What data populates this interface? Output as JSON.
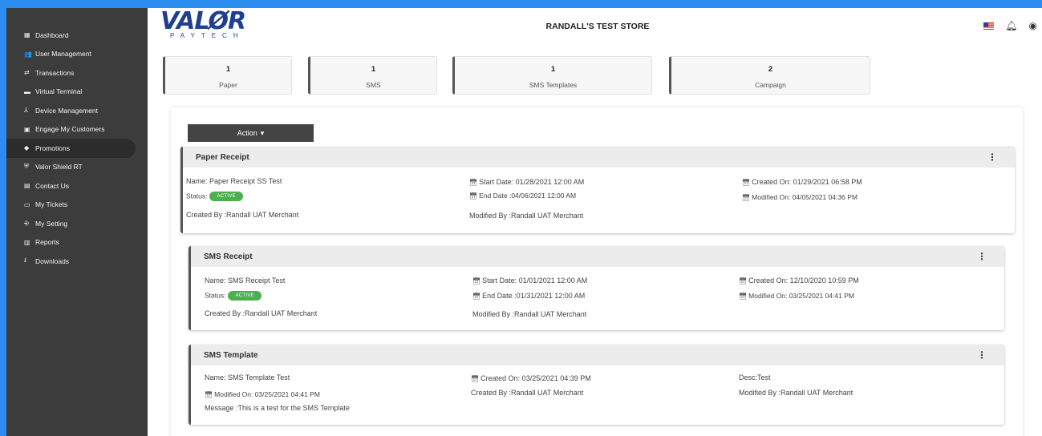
{
  "sidebar": {
    "items": [
      {
        "label": "Dashboard",
        "icon": "dashboard-icon",
        "glyph": "▦"
      },
      {
        "label": "User Management",
        "icon": "users-icon",
        "glyph": "👥"
      },
      {
        "label": "Transactions",
        "icon": "transfer-icon",
        "glyph": "⇄"
      },
      {
        "label": "Virtual Terminal",
        "icon": "terminal-icon",
        "glyph": "▬"
      },
      {
        "label": "Device Management",
        "icon": "device-tree-icon",
        "glyph": "⅄"
      },
      {
        "label": "Engage My Customers",
        "icon": "engage-icon",
        "glyph": "▣"
      },
      {
        "label": "Promotions",
        "icon": "tag-icon",
        "glyph": "◆"
      },
      {
        "label": "Valor Shield RT",
        "icon": "shield-icon",
        "glyph": "⛨"
      },
      {
        "label": "Contact Us",
        "icon": "contact-icon",
        "glyph": "▤"
      },
      {
        "label": "My Tickets",
        "icon": "ticket-icon",
        "glyph": "▭"
      },
      {
        "label": "My Setting",
        "icon": "login-icon",
        "glyph": "⎆"
      },
      {
        "label": "Reports",
        "icon": "report-icon",
        "glyph": "▥"
      },
      {
        "label": "Downloads",
        "icon": "download-icon",
        "glyph": "⭳"
      }
    ],
    "active_index": 6
  },
  "header": {
    "logo_main": "VALØR",
    "logo_sub": "PAYTECH",
    "store_title": "RANDALL'S TEST STORE"
  },
  "summary": [
    {
      "count": "1",
      "label": "Paper"
    },
    {
      "count": "1",
      "label": "SMS"
    },
    {
      "count": "1",
      "label": "SMS Templates"
    },
    {
      "count": "2",
      "label": "Campaign"
    }
  ],
  "action_label": "Action",
  "promos": {
    "paper": {
      "title": "Paper Receipt",
      "name": "Name: Paper Receipt SS Test",
      "status_label": "Status:",
      "status": "ACTIVE",
      "created_by": "Created By :Randall UAT Merchant",
      "start": "Start Date: 01/28/2021 12:00 AM",
      "end": "End Date :04/06/2021 12:00 AM",
      "modified_by": "Modified By :Randall UAT Merchant",
      "created_on": "Created On: 01/29/2021 06:58 PM",
      "modified_on": "Modified On: 04/05/2021 04:36 PM"
    },
    "sms": {
      "title": "SMS Receipt",
      "name": "Name: SMS Receipt Test",
      "status_label": "Status:",
      "status": "ACTIVE",
      "created_by": "Created By :Randall UAT Merchant",
      "start": "Start Date: 01/01/2021 12:00 AM",
      "end": "End Date :01/31/2021 12:00 AM",
      "modified_by": "Modified By :Randall UAT Merchant",
      "created_on": "Created On: 12/10/2020 10:59 PM",
      "modified_on": "Modified On: 03/25/2021 04:41 PM"
    },
    "template": {
      "title": "SMS Template",
      "name": "Name: SMS Template Test",
      "modified_on": "Modified On: 03/25/2021 04:41 PM",
      "message": "Message :This is a test for the SMS Template",
      "created_on": "Created On: 03/25/2021 04:39 PM",
      "created_by": "Created By :Randall UAT Merchant",
      "desc": "Desc:Test",
      "modified_by": "Modified By :Randall UAT Merchant"
    }
  },
  "colors": {
    "accent": "#2b8df0",
    "sidebar": "#3c3c3c",
    "active_badge": "#4caf50",
    "logo": "#1f3f8f"
  }
}
